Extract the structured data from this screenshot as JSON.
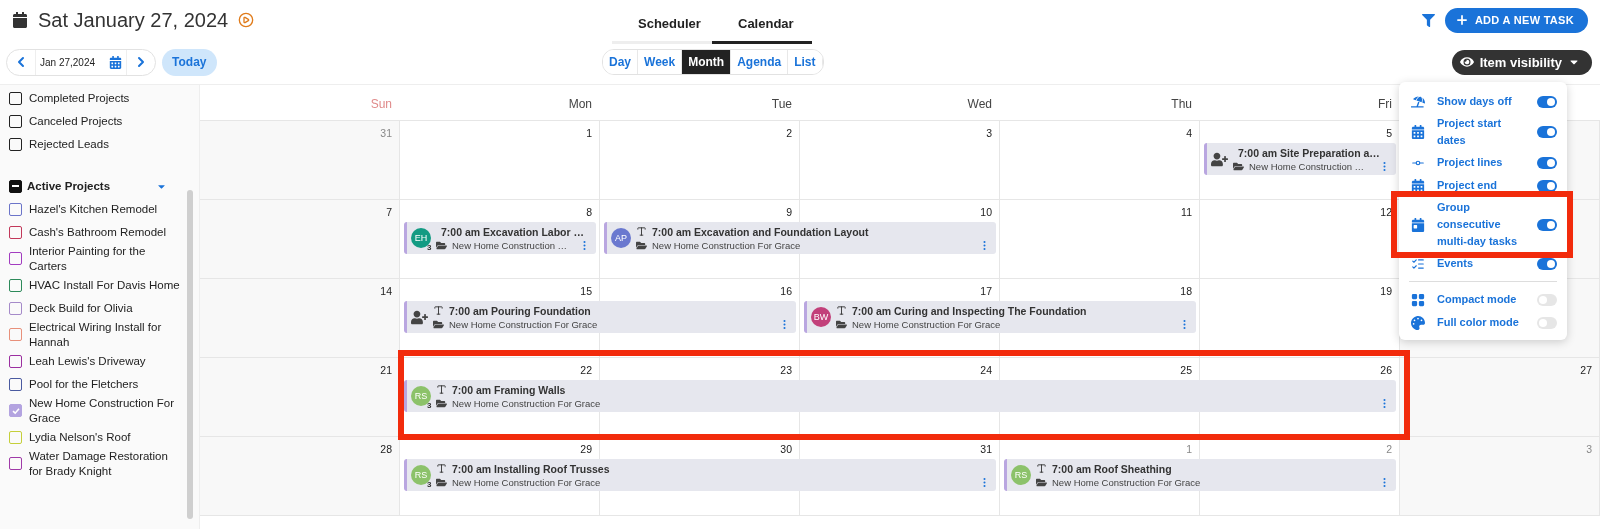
{
  "header": {
    "date": "Sat January 27, 2024",
    "tabs": [
      {
        "label": "Scheduler",
        "selected": false
      },
      {
        "label": "Calendar",
        "selected": true
      }
    ],
    "add_button": "ADD A NEW TASK"
  },
  "toolbar": {
    "date_field": "Jan 27,2024",
    "today": "Today",
    "views": [
      {
        "label": "Day",
        "selected": false
      },
      {
        "label": "Week",
        "selected": false
      },
      {
        "label": "Month",
        "selected": true
      },
      {
        "label": "Agenda",
        "selected": false
      },
      {
        "label": "List",
        "selected": false
      }
    ],
    "visibility_button": "Item visibility"
  },
  "sidebar": {
    "filters": [
      {
        "label": "Completed Projects",
        "checked": false
      },
      {
        "label": "Canceled Projects",
        "checked": false
      },
      {
        "label": "Rejected Leads",
        "checked": false
      }
    ],
    "active_projects": {
      "label": "Active Projects",
      "indeterminate": true,
      "expanded": true,
      "items": [
        {
          "label": "Hazel's Kitchen Remodel",
          "color": "#6b74c9",
          "checked": false
        },
        {
          "label": "Cash's Bathroom Remodel",
          "color": "#c2385a",
          "checked": false
        },
        {
          "label": "Interior Painting for the Carters",
          "color": "#a23cc0",
          "checked": false
        },
        {
          "label": "HVAC Install For Davis Home",
          "color": "#2d8a5a",
          "checked": false
        },
        {
          "label": "Deck Build for Olivia",
          "color": "#a58ac9",
          "checked": false
        },
        {
          "label": "Electrical Wiring Install for Hannah",
          "color": "#e8907a",
          "checked": false
        },
        {
          "label": "Leah Lewis's Driveway",
          "color": "#9b2fa0",
          "checked": false
        },
        {
          "label": "Pool for the Fletchers",
          "color": "#4a5aa0",
          "checked": false
        },
        {
          "label": "New Home Construction For Grace",
          "color": "#b3a3e0",
          "checked": true
        },
        {
          "label": "Lydia Nelson's Roof",
          "color": "#c5cf3a",
          "checked": false
        },
        {
          "label": "Water Damage Restoration for Brady Knight",
          "color": "#a03aa8",
          "checked": false
        }
      ]
    }
  },
  "calendar": {
    "weekdays": [
      {
        "label": "Sun",
        "weekend": true
      },
      {
        "label": "Mon",
        "weekend": false
      },
      {
        "label": "Tue",
        "weekend": false
      },
      {
        "label": "Wed",
        "weekend": false
      },
      {
        "label": "Thu",
        "weekend": false
      },
      {
        "label": "Fri",
        "weekend": false
      }
    ],
    "weeks": [
      {
        "days": [
          {
            "number": "31",
            "muted": true
          },
          {
            "number": "1",
            "muted": false
          },
          {
            "number": "2",
            "muted": false
          },
          {
            "number": "3",
            "muted": false
          },
          {
            "number": "4",
            "muted": false
          },
          {
            "number": "5",
            "muted": false,
            "task": {
              "title": "7:00 am Site Preparation a…",
              "project": "New Home Construction …",
              "avatar": {
                "kind": "add-person"
              },
              "highlighted": false
            }
          }
        ]
      },
      {
        "days": [
          {
            "number": "7",
            "muted": false
          },
          {
            "number": "8",
            "muted": false,
            "task": {
              "title": "7:00 am Excavation Labor …",
              "project": "New Home Construction …",
              "avatar": {
                "kind": "initials",
                "initials": "EH",
                "color": "#139b83",
                "count": "3"
              },
              "highlighted": false
            }
          },
          {
            "number": "9",
            "muted": false,
            "task": {
              "title": "7:00 am Excavation and Foundation Layout",
              "project": "New Home Construction For Grace",
              "avatar": {
                "kind": "initials",
                "initials": "AP",
                "color": "#6a78cf"
              },
              "highlighted": false
            }
          },
          {
            "number": "10",
            "muted": false,
            "continues": true
          },
          {
            "number": "11",
            "muted": false
          },
          {
            "number": "12",
            "muted": false
          }
        ]
      },
      {
        "days": [
          {
            "number": "14",
            "muted": false
          },
          {
            "number": "15",
            "muted": false,
            "task": {
              "title": "7:00 am Pouring Foundation",
              "project": "New Home Construction For Grace",
              "avatar": {
                "kind": "add-person"
              },
              "highlighted": false
            }
          },
          {
            "number": "16",
            "muted": false,
            "continues": true
          },
          {
            "number": "17",
            "muted": false,
            "task": {
              "title": "7:00 am Curing and Inspecting The Foundation",
              "project": "New Home Construction For Grace",
              "avatar": {
                "kind": "initials",
                "initials": "BW",
                "color": "#c2407a"
              },
              "highlighted": false
            }
          },
          {
            "number": "18",
            "muted": false,
            "continues": true
          },
          {
            "number": "19",
            "muted": false
          }
        ]
      },
      {
        "days": [
          {
            "number": "21",
            "muted": false
          },
          {
            "number": "22",
            "muted": false,
            "task": {
              "title": "7:00 am Framing Walls",
              "project": "New Home Construction For Grace",
              "avatar": {
                "kind": "initials",
                "initials": "RS",
                "color": "#8cc26a",
                "count": "3"
              },
              "highlighted": true
            }
          },
          {
            "number": "23",
            "muted": false,
            "continues": true
          },
          {
            "number": "24",
            "muted": false,
            "continues": true
          },
          {
            "number": "25",
            "muted": false,
            "continues": true
          },
          {
            "number": "26",
            "muted": false,
            "continues": true
          },
          {
            "number": "27",
            "muted": false
          }
        ]
      },
      {
        "days": [
          {
            "number": "28",
            "muted": false
          },
          {
            "number": "29",
            "muted": false,
            "task": {
              "title": "7:00 am Installing Roof Trusses",
              "project": "New Home Construction For Grace",
              "avatar": {
                "kind": "initials",
                "initials": "RS",
                "color": "#8cc26a",
                "count": "3"
              },
              "highlighted": false
            }
          },
          {
            "number": "30",
            "muted": false,
            "continues": true
          },
          {
            "number": "31",
            "muted": false,
            "continues": true
          },
          {
            "number": "1",
            "muted": true,
            "task": {
              "title": "7:00 am Roof Sheathing",
              "project": "New Home Construction For Grace",
              "avatar": {
                "kind": "initials",
                "initials": "RS",
                "color": "#8cc26a"
              },
              "highlighted": false
            }
          },
          {
            "number": "2",
            "muted": true,
            "continues": true
          },
          {
            "number": "3",
            "muted": true
          }
        ]
      }
    ]
  },
  "visibility_menu": {
    "groups": [
      [
        {
          "label": "Show days off",
          "on": true,
          "highlighted": false
        },
        {
          "label": "Project start dates",
          "on": true,
          "highlighted": false
        },
        {
          "label": "Project lines",
          "on": true,
          "highlighted": false
        },
        {
          "label": "Project end",
          "on": true,
          "highlighted": false
        },
        {
          "label": "Group consecutive multi-day tasks",
          "on": true,
          "highlighted": true
        },
        {
          "label": "Events",
          "on": true,
          "highlighted": false
        }
      ],
      [
        {
          "label": "Compact mode",
          "on": false,
          "highlighted": false
        },
        {
          "label": "Full color mode",
          "on": false,
          "highlighted": false
        }
      ]
    ]
  }
}
